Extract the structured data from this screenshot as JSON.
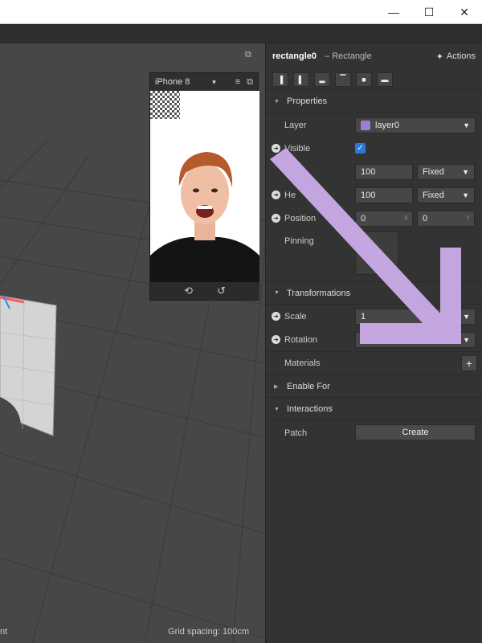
{
  "window": {
    "minimize_icon": "minimize-icon",
    "maximize_icon": "maximize-icon",
    "close_icon": "close-icon",
    "minimize_glyph": "—",
    "maximize_glyph": "☐",
    "close_glyph": "✕"
  },
  "viewport": {
    "left_text": "nt",
    "grid_spacing": "Grid spacing: 100cm",
    "popout_icon": "popout-icon"
  },
  "simulator": {
    "device": "iPhone 8",
    "chevron": "▾",
    "menu_glyph": "≡",
    "popout_glyph": "⧉",
    "footer_icons": [
      "camera-switch-icon",
      "restart-icon"
    ],
    "footer_glyphs": [
      "⟲",
      "↺"
    ]
  },
  "inspector": {
    "object_name": "rectangle0",
    "object_type": "– Rectangle",
    "actions_label": "Actions",
    "actions_glyph": "✦",
    "align_glyphs": [
      "▐",
      "▌",
      "▂",
      "▔",
      "■",
      "▬"
    ],
    "sections": {
      "properties": "Properties",
      "transformations": "Transformations",
      "materials": "Materials",
      "enable_for": "Enable For",
      "interactions": "Interactions"
    },
    "layer": {
      "label": "Layer",
      "value": "layer0",
      "swatch_color": "#9b7fd6"
    },
    "visible": {
      "label": "Visible",
      "checked": true,
      "check_glyph": "✓"
    },
    "width": {
      "value": "100",
      "mode": "Fixed"
    },
    "height": {
      "label": "He",
      "value": "100",
      "mode": "Fixed"
    },
    "position": {
      "label": "Position",
      "x": "0",
      "y": "0",
      "x_axis": "X",
      "y_axis": "Y"
    },
    "pinning": {
      "label": "Pinning"
    },
    "scale": {
      "label": "Scale",
      "value": "1"
    },
    "rotation": {
      "label": "Rotation"
    },
    "materials_add_glyph": "+",
    "patch": {
      "label": "Patch",
      "button": "Create"
    }
  },
  "colors": {
    "accent_blue": "#2a7ad9",
    "annotation_arrow": "#c8a9e6"
  }
}
